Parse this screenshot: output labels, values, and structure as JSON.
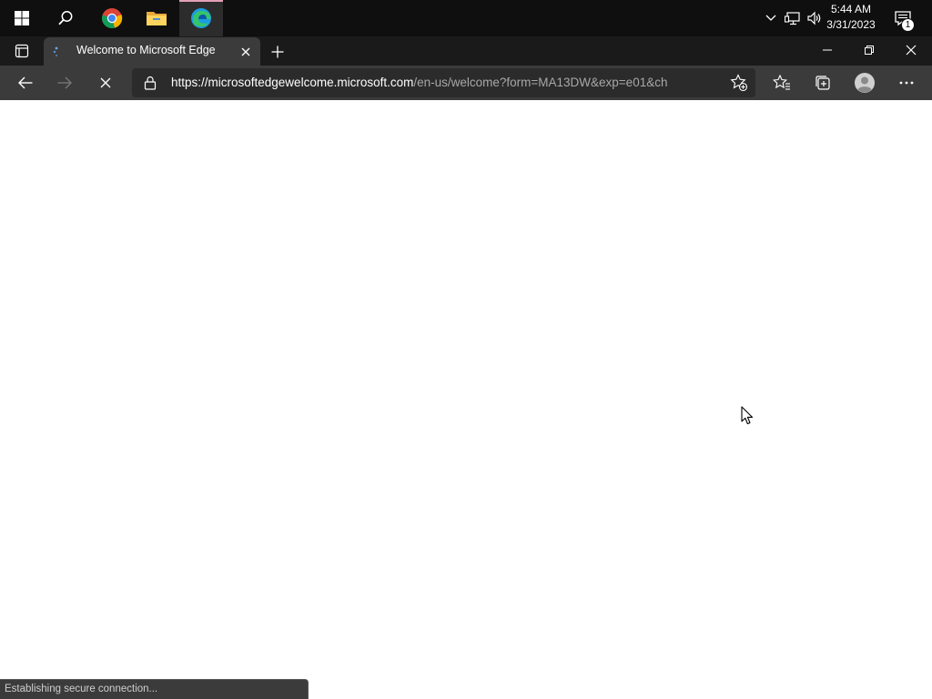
{
  "taskbar": {
    "apps": [
      {
        "name": "Start",
        "icon": "windows-logo-icon"
      },
      {
        "name": "Search",
        "icon": "search-icon"
      },
      {
        "name": "Google Chrome",
        "icon": "chrome-icon"
      },
      {
        "name": "File Explorer",
        "icon": "folder-icon"
      },
      {
        "name": "Microsoft Edge",
        "icon": "edge-icon",
        "active": true
      }
    ],
    "tray": {
      "time": "5:44 AM",
      "date": "3/31/2023",
      "notification_count": "1"
    }
  },
  "browser": {
    "tab": {
      "title": "Welcome to Microsoft Edge",
      "loading": true
    },
    "address": {
      "url_host": "https://microsoftedgewelcome.microsoft.com",
      "url_path": "/en-us/welcome?form=MA13DW&exp=e01&ch"
    },
    "status_text": "Establishing secure connection..."
  },
  "colors": {
    "taskbar": "#0f0f0f",
    "tabstrip": "#1a1a1a",
    "toolbar": "#3b3b3b",
    "active_indicator": "#e3a0b4"
  }
}
